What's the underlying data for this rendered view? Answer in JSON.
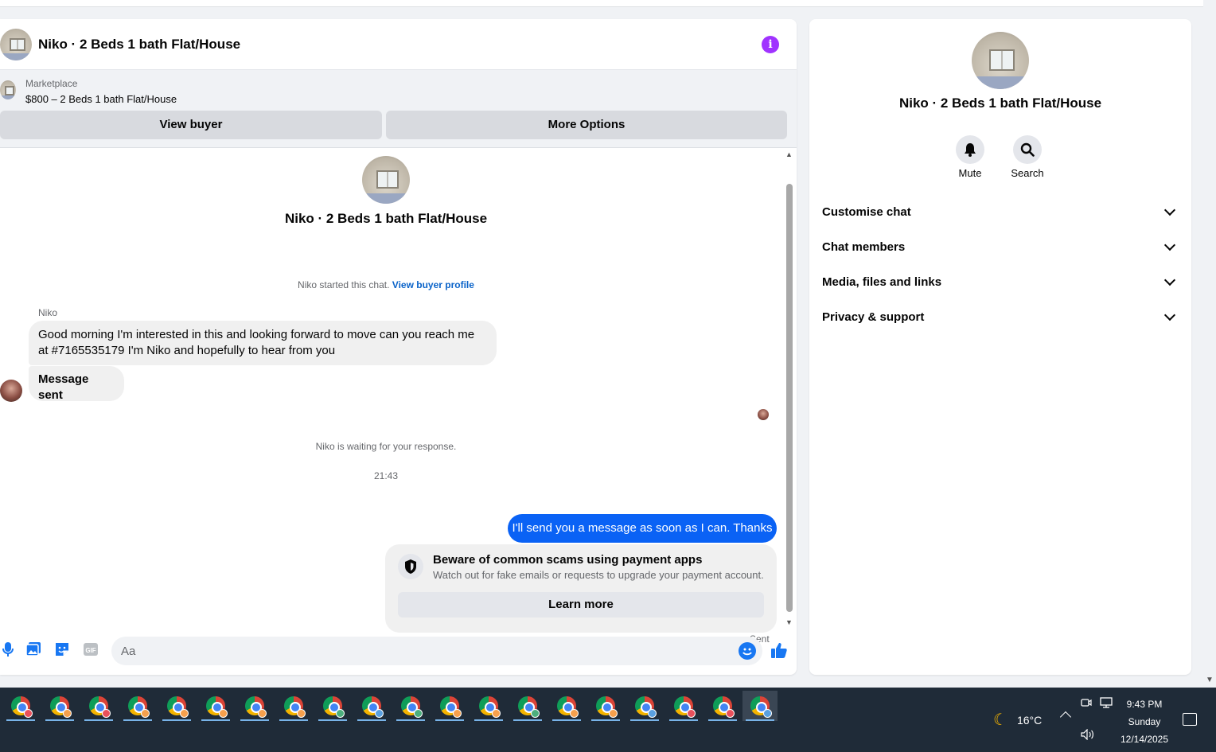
{
  "header": {
    "title": "Niko · 2 Beds 1 bath Flat/House"
  },
  "marketplace": {
    "label": "Marketplace",
    "item": "$800 – 2 Beds 1 bath Flat/House",
    "view_buyer": "View buyer",
    "more_options": "More Options"
  },
  "conversation": {
    "title": "Niko · 2 Beds 1 bath Flat/House",
    "started_text": "Niko started this chat.",
    "started_link": "View buyer profile",
    "sender": "Niko",
    "messages_in": [
      "Good morning I'm interested in this and looking forward to move can you reach me at #7165535179 I'm Niko and hopefully to hear from you",
      "Message sent"
    ],
    "waiting": "Niko is waiting for your response.",
    "time": "21:43",
    "message_out": "I'll send you a message as soon as I can. Thanks",
    "scam_title": "Beware of common scams using payment apps",
    "scam_sub": "Watch out for fake emails or requests to upgrade your payment account.",
    "learn_more": "Learn more",
    "sent_status": "Sent"
  },
  "composer": {
    "placeholder": "Aa",
    "icons": [
      "microphone-icon",
      "photo-icon",
      "sticker-icon",
      "gif-icon",
      "emoji-icon",
      "thumbs-up-icon"
    ]
  },
  "sidebar": {
    "title": "Niko · 2 Beds 1 bath Flat/House",
    "mute": "Mute",
    "search": "Search",
    "sections": [
      "Customise chat",
      "Chat members",
      "Media, files and links",
      "Privacy & support"
    ]
  },
  "taskbar": {
    "temperature": "16°C",
    "time": "9:43 PM",
    "day": "Sunday",
    "date": "12/14/2025"
  },
  "colors": {
    "accent": "#0a62f5",
    "info": "#a033ff",
    "link": "#0a63c9"
  }
}
